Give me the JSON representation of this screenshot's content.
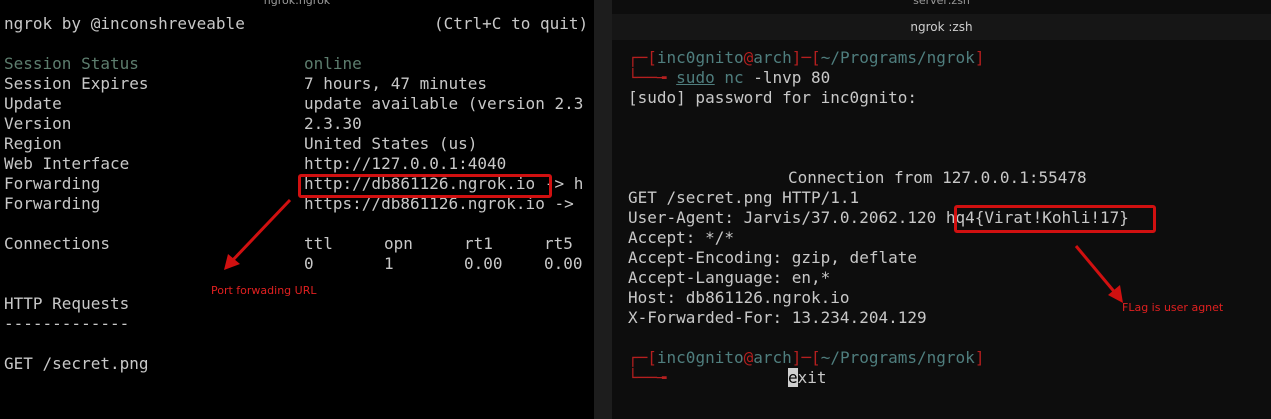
{
  "left": {
    "title": "ngrok:ngrok",
    "header": "ngrok by @inconshreveable",
    "quit_hint": "(Ctrl+C to quit)",
    "rows": [
      {
        "label": "Session Status",
        "value": "online",
        "dim": true
      },
      {
        "label": "Session Expires",
        "value": "7 hours, 47 minutes"
      },
      {
        "label": "Update",
        "value": "update available (version 2.3"
      },
      {
        "label": "Version",
        "value": "2.3.30"
      },
      {
        "label": "Region",
        "value": "United States (us)"
      },
      {
        "label": "Web Interface",
        "value": "http://127.0.0.1:4040"
      },
      {
        "label": "Forwarding",
        "value": "http://db861126.ngrok.io -> h"
      },
      {
        "label": "Forwarding",
        "value": "https://db861126.ngrok.io ->"
      }
    ],
    "connections": {
      "label": "Connections",
      "headers": [
        "ttl",
        "opn",
        "rt1",
        "rt5"
      ],
      "values": [
        "0",
        "1",
        "0.00",
        "0.00"
      ]
    },
    "http_requests": "HTTP Requests",
    "separator": "-------------",
    "request": "GET /secret.png",
    "annotation": "Port forwading URL"
  },
  "right": {
    "title": "server:zsh",
    "tab": "ngrok :zsh",
    "prompt1": {
      "user": "inc0gnito",
      "host": "arch",
      "path": "~/Programs/ngrok"
    },
    "command": {
      "sudo": "sudo",
      "nc": "nc",
      "args": "-lnvp 80"
    },
    "sudo_prompt": "[sudo] password for inc0gnito:",
    "connection": "Connection from 127.0.0.1:55478",
    "request_lines": [
      "GET /secret.png HTTP/1.1",
      "User-Agent: Jarvis/37.0.2062.120",
      "Accept: */*",
      "Accept-Encoding: gzip, deflate",
      "Accept-Language: en,*",
      "Host: db861126.ngrok.io",
      "X-Forwarded-For: 13.234.204.129"
    ],
    "flag": "hq4{Virat!Kohli!17}",
    "prompt2": {
      "user": "inc0gnito",
      "host": "arch",
      "path": "~/Programs/ngrok"
    },
    "exit_cursor": "e",
    "exit_rest": "xit",
    "annotation": "FLag is user agnet"
  },
  "colors": {
    "annotation_red": "#d01010",
    "bg": "#000000"
  }
}
